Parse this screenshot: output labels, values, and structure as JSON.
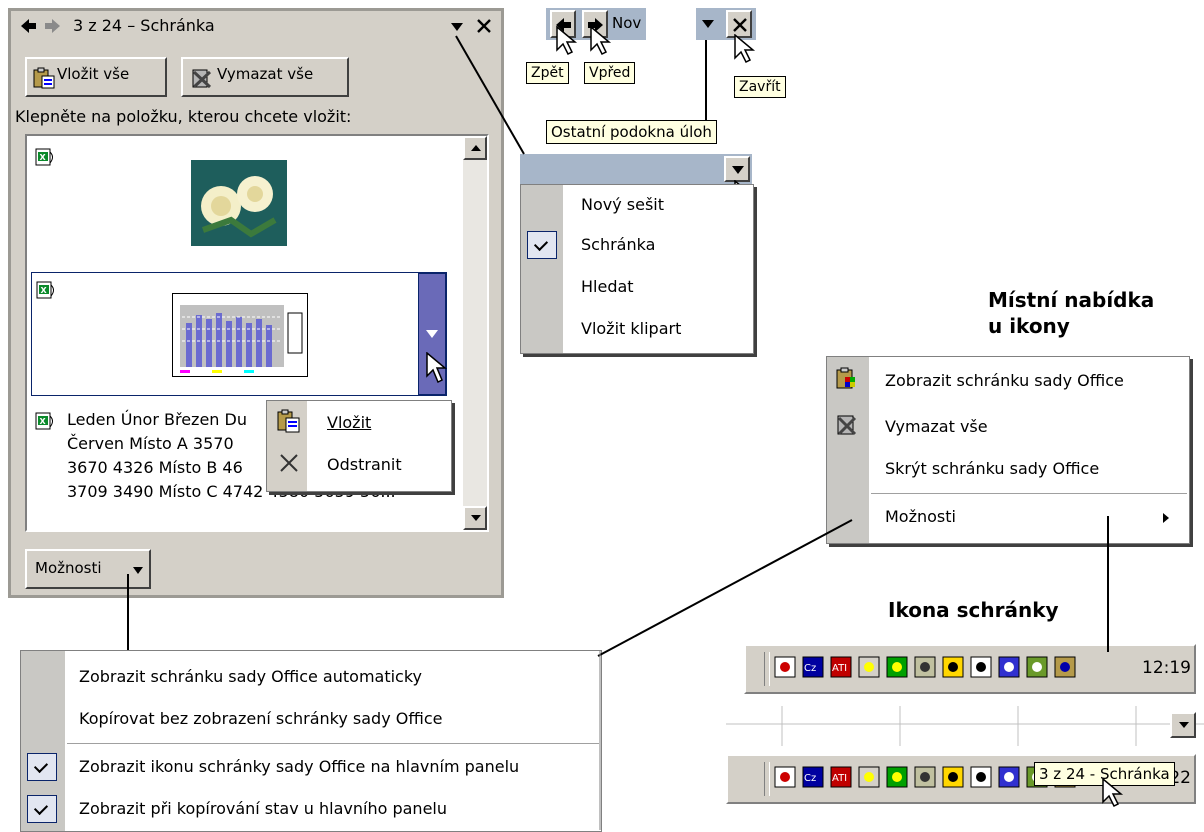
{
  "task_pane": {
    "title": "3 z 24 – Schránka",
    "paste_all": "Vložit vše",
    "clear_all": "Vymazat vše",
    "instruction": "Klepněte na položku, kterou chcete vložit:",
    "text_item_lines": [
      "Leden Únor Březen Du",
      "Červen Místo A 3570",
      "3670 4326 Místo B 46",
      "3709 3490 Místo C 4742 4580 5659 56..."
    ],
    "options_button": "Možnosti"
  },
  "item_menu": {
    "paste": "Vložit",
    "remove": "Odstranit"
  },
  "nav_tooltips": {
    "back": "Zpět",
    "forward": "Vpřed",
    "close": "Zavřít",
    "nov_fragment": "Nov",
    "other_panes": "Ostatní podokna úloh"
  },
  "pane_dropdown": {
    "items": [
      "Nový sešit",
      "Schránka",
      "Hledat",
      "Vložit klipart"
    ],
    "checked": "Schránka"
  },
  "context_menu": {
    "heading_line1": "Místní nabídka",
    "heading_line2": "u ikony",
    "items": [
      "Zobrazit schránku sady Office",
      "Vymazat vše",
      "Skrýt schránku sady Office",
      "Možnosti"
    ]
  },
  "options_menu": {
    "items": [
      "Zobrazit schránku sady Office automaticky",
      "Kopírovat bez zobrazení schránky sady Office",
      "Zobrazit ikonu schránky sady Office na hlavním panelu",
      "Zobrazit při kopírování stav u hlavního panelu"
    ]
  },
  "tray": {
    "heading": "Ikona schránky",
    "clock1": "12:19",
    "clock2": "12:22",
    "tooltip": "3 z 24 - Schránka"
  }
}
